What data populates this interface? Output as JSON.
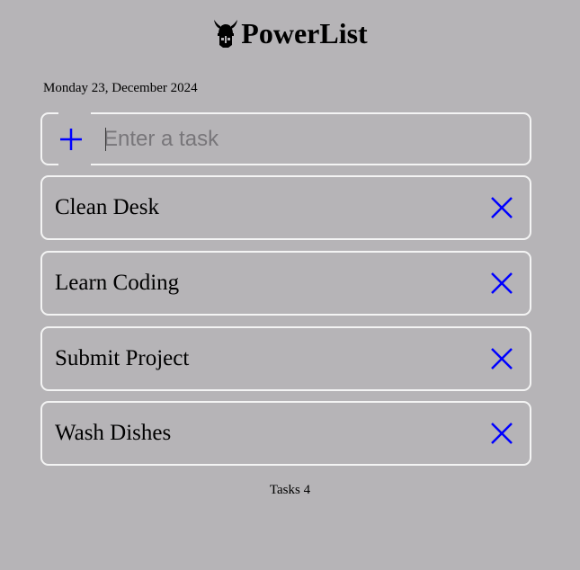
{
  "header": {
    "title": "PowerList",
    "logo_icon": "viking-helmet-icon"
  },
  "date": "Monday 23, December 2024",
  "input": {
    "placeholder": "Enter a task",
    "value": "",
    "add_icon": "plus-icon"
  },
  "tasks": [
    {
      "label": "Clean Desk",
      "delete_icon": "close-icon"
    },
    {
      "label": "Learn Coding",
      "delete_icon": "close-icon"
    },
    {
      "label": "Submit Project",
      "delete_icon": "close-icon"
    },
    {
      "label": "Wash Dishes",
      "delete_icon": "close-icon"
    }
  ],
  "footer": {
    "tasks_count": "Tasks 4"
  },
  "colors": {
    "background": "#b6b4b7",
    "border": "#f4f4f4",
    "accent": "#0000ff"
  }
}
